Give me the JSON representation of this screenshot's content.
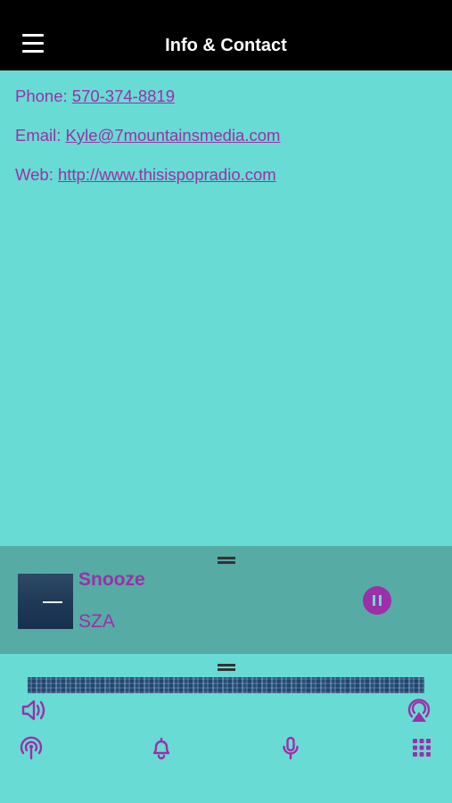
{
  "header": {
    "title": "Info & Contact",
    "menu_icon": "hamburger-icon"
  },
  "contact": {
    "phone_label": "Phone: ",
    "phone_value": "570-374-8819",
    "email_label": "Email: ",
    "email_value": "Kyle@7mountainsmedia.com",
    "web_label": "Web: ",
    "web_value": "http://www.thisispopradio.com"
  },
  "now_playing": {
    "title": "Snooze",
    "artist": "SZA",
    "state": "playing",
    "control_icon": "pause-icon"
  },
  "bottom_bar": {
    "icons": [
      "volume-icon",
      "airplay-icon",
      "podcast-icon",
      "bell-icon",
      "microphone-icon",
      "grid-icon"
    ]
  },
  "colors": {
    "background": "#68dbd4",
    "header": "#000000",
    "accent": "#9b30a8",
    "player_bg": "#56aba5"
  }
}
